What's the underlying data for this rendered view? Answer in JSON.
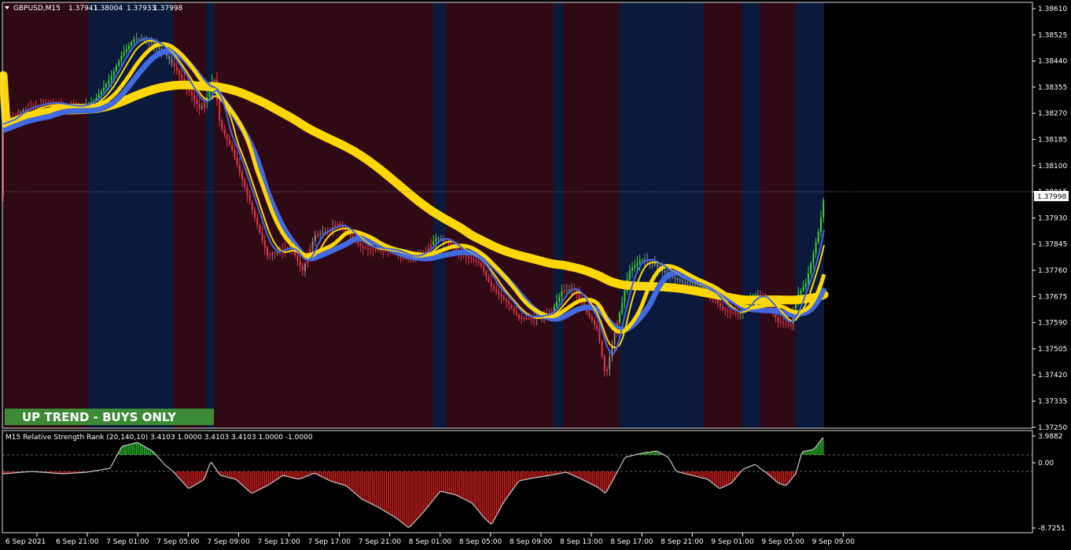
{
  "symbol": {
    "label": "GBPUSD,M15",
    "open": "1.37941",
    "high": "1.38004",
    "low": "1.37933",
    "close": "1.37998"
  },
  "indicator": {
    "label": "M15 Relative Strength Rank (20,140,10) 3.4103 1.0000 3.4103 3.4103 1.0000 -1.0000",
    "levels": [
      "3.9882",
      "0.00",
      "-8.7251"
    ]
  },
  "banner": {
    "text": "UP TREND - BUYS ONLY",
    "color": "#3c8a36"
  },
  "price_axis": {
    "ticks": [
      "1.38610",
      "1.38525",
      "1.38440",
      "1.38355",
      "1.38270",
      "1.38185",
      "1.38100",
      "1.38015",
      "1.37930",
      "1.37845",
      "1.37760",
      "1.37675",
      "1.37590",
      "1.37505",
      "1.37420",
      "1.37335",
      "1.37250"
    ],
    "current_price": "1.37998",
    "range": [
      1.3725,
      1.3861
    ]
  },
  "time_axis": {
    "labels": [
      "6 Sep 2021",
      "6 Sep 21:00",
      "7 Sep 01:00",
      "7 Sep 05:00",
      "7 Sep 09:00",
      "7 Sep 13:00",
      "7 Sep 17:00",
      "7 Sep 21:00",
      "8 Sep 01:00",
      "8 Sep 05:00",
      "8 Sep 09:00",
      "8 Sep 13:00",
      "8 Sep 17:00",
      "8 Sep 21:00",
      "9 Sep 01:00",
      "9 Sep 05:00",
      "9 Sep 09:00"
    ]
  },
  "colors": {
    "bull_bg": "#0b1a3c",
    "bear_bg": "#2f0a14",
    "bull_candle": "#3fd13a",
    "bear_candle": "#e0384a",
    "neutral_candle": "#8a8a8a",
    "slow_ma": "#ffd700",
    "fast_ma": "#ffd700",
    "blue_band": "#4169e1",
    "hist_up": "#2ecc2e",
    "hist_down": "#e02020"
  }
}
